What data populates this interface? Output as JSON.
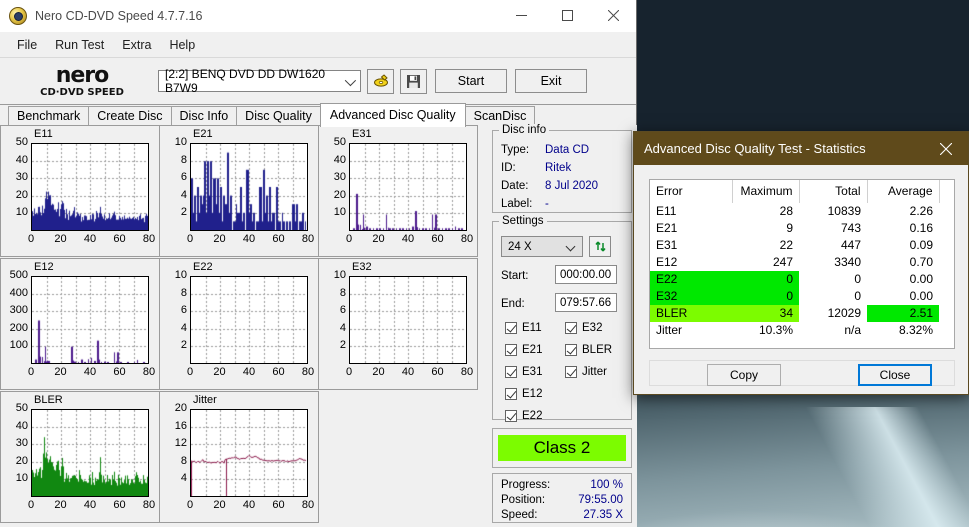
{
  "window": {
    "title": "Nero CD-DVD Speed 4.7.7.16",
    "icon": "nero-disc-icon",
    "minimize_label": "minimize-icon",
    "maximize_label": "maximize-icon",
    "close_label": "close-icon"
  },
  "menu": {
    "items": [
      "File",
      "Run Test",
      "Extra",
      "Help"
    ]
  },
  "toolbar": {
    "logo_line1": "nero",
    "logo_line2": "CD·DVD SPEED",
    "drive": "[2:2]   BENQ DVD DD DW1620 B7W9",
    "eject_icon": "eject-disc-icon",
    "save_icon": "floppy-save-icon",
    "start_label": "Start",
    "exit_label": "Exit"
  },
  "tabs": {
    "items": [
      "Benchmark",
      "Create Disc",
      "Disc Info",
      "Disc Quality",
      "Advanced Disc Quality",
      "ScanDisc"
    ],
    "active": "Advanced Disc Quality"
  },
  "disc_info": {
    "legend": "Disc info",
    "rows": [
      {
        "key": "Type:",
        "value": "Data CD"
      },
      {
        "key": "ID:",
        "value": "Ritek"
      },
      {
        "key": "Date:",
        "value": "8 Jul 2020"
      },
      {
        "key": "Label:",
        "value": "-"
      }
    ]
  },
  "settings": {
    "legend": "Settings",
    "speed": "24 X",
    "refresh_icon": "refresh-speed-icon",
    "start_label": "Start:",
    "start_value": "000:00.00",
    "end_label": "End:",
    "end_value": "079:57.66",
    "checkboxes_left": [
      "E11",
      "E21",
      "E31",
      "E12",
      "E22"
    ],
    "checkboxes_right": [
      "E32",
      "BLER",
      "Jitter"
    ]
  },
  "class": {
    "label": "Class 2",
    "color": "#7cfc00"
  },
  "progress": {
    "rows": [
      {
        "key": "Progress:",
        "value": "100 %"
      },
      {
        "key": "Position:",
        "value": "79:55.00"
      },
      {
        "key": "Speed:",
        "value": "27.35 X"
      }
    ]
  },
  "stats_dialog": {
    "title": "Advanced Disc Quality Test - Statistics",
    "close_icon": "close-icon",
    "columns": [
      "Error",
      "Maximum",
      "Total",
      "Average"
    ],
    "rows": [
      {
        "error": "E11",
        "maximum": "28",
        "total": "10839",
        "average": "2.26",
        "hl_error": false,
        "hl_max": false,
        "hl_avg": false
      },
      {
        "error": "E21",
        "maximum": "9",
        "total": "743",
        "average": "0.16",
        "hl_error": false,
        "hl_max": false,
        "hl_avg": false
      },
      {
        "error": "E31",
        "maximum": "22",
        "total": "447",
        "average": "0.09",
        "hl_error": false,
        "hl_max": false,
        "hl_avg": false
      },
      {
        "error": "E12",
        "maximum": "247",
        "total": "3340",
        "average": "0.70",
        "hl_error": false,
        "hl_max": false,
        "hl_avg": false
      },
      {
        "error": "E22",
        "maximum": "0",
        "total": "0",
        "average": "0.00",
        "hl_error": true,
        "hl_max": true,
        "hl_avg": false,
        "hl_color": "#00e800"
      },
      {
        "error": "E32",
        "maximum": "0",
        "total": "0",
        "average": "0.00",
        "hl_error": true,
        "hl_max": true,
        "hl_avg": false,
        "hl_color": "#00e800"
      },
      {
        "error": "BLER",
        "maximum": "34",
        "total": "12029",
        "average": "2.51",
        "hl_error": true,
        "hl_max": true,
        "hl_avg": true,
        "hl_color": "#7cfc00",
        "hl_avg_color": "#00e800"
      },
      {
        "error": "Jitter",
        "maximum": "10.3%",
        "total": "n/a",
        "average": "8.32%",
        "hl_error": false,
        "hl_max": false,
        "hl_avg": false
      }
    ],
    "copy_label": "Copy",
    "close_label": "Close"
  },
  "chart_data": [
    {
      "type": "bar",
      "title": "E11",
      "xlabel": "",
      "ylabel": "",
      "xlim": [
        0,
        80
      ],
      "ylim": [
        0,
        50
      ],
      "yticks": [
        10,
        20,
        30,
        40,
        50
      ],
      "xticks": [
        0,
        20,
        40,
        60,
        80
      ],
      "color": "#20208c",
      "grid": true,
      "x": [
        0,
        1,
        2,
        3,
        4,
        5,
        6,
        7,
        8,
        9,
        10,
        11,
        12,
        13,
        14,
        15,
        16,
        17,
        18,
        19,
        20,
        21,
        22,
        23,
        24,
        25,
        26,
        27,
        28,
        29,
        30,
        31,
        32,
        33,
        34,
        35,
        36,
        37,
        38,
        39,
        40,
        41,
        42,
        43,
        44,
        45,
        46,
        47,
        48,
        49,
        50,
        51,
        52,
        53,
        54,
        55,
        56,
        57,
        58,
        59,
        60,
        61,
        62,
        63,
        64,
        65,
        66,
        67,
        68,
        69,
        70,
        71,
        72,
        73,
        74,
        75,
        76,
        77,
        78,
        79,
        80
      ],
      "values": [
        14,
        9,
        12,
        10,
        15,
        11,
        8,
        13,
        10,
        18,
        27,
        20,
        26,
        13,
        19,
        12,
        10,
        14,
        16,
        9,
        12,
        17,
        10,
        9,
        12,
        8,
        10,
        7,
        9,
        12,
        7,
        10,
        8,
        11,
        6,
        9,
        7,
        10,
        8,
        6,
        9,
        7,
        10,
        6,
        8,
        11,
        7,
        14,
        8,
        7,
        9,
        6,
        8,
        7,
        9,
        6,
        8,
        10,
        7,
        6,
        9,
        7,
        8,
        6,
        9,
        7,
        8,
        6,
        7,
        9,
        6,
        8,
        7,
        9,
        6,
        8,
        7,
        9,
        6,
        8,
        7
      ]
    },
    {
      "type": "bar",
      "title": "E21",
      "xlabel": "",
      "ylabel": "",
      "xlim": [
        0,
        80
      ],
      "ylim": [
        0,
        10
      ],
      "yticks": [
        2,
        4,
        6,
        8,
        10
      ],
      "xticks": [
        0,
        20,
        40,
        60,
        80
      ],
      "color": "#20208c",
      "grid": true,
      "x": [
        0,
        1,
        2,
        3,
        4,
        5,
        6,
        7,
        8,
        9,
        10,
        11,
        12,
        13,
        14,
        15,
        16,
        17,
        18,
        19,
        20,
        21,
        22,
        23,
        24,
        25,
        26,
        27,
        28,
        29,
        30,
        31,
        32,
        33,
        34,
        35,
        36,
        37,
        38,
        39,
        40,
        41,
        42,
        43,
        44,
        45,
        46,
        47,
        48,
        49,
        50,
        51,
        52,
        53,
        54,
        55,
        56,
        57,
        58,
        59,
        60,
        61,
        62,
        63,
        64,
        65,
        66,
        67,
        68,
        69,
        70,
        71,
        72,
        73,
        74,
        75,
        76,
        77,
        78,
        79,
        80
      ],
      "values": [
        6,
        2,
        4,
        1,
        5,
        2,
        4,
        1,
        3,
        4,
        8,
        2,
        8,
        4,
        8,
        2,
        6,
        3,
        6,
        2,
        5,
        1,
        4,
        2,
        3,
        1,
        9,
        2,
        4,
        0,
        1,
        3,
        1,
        2,
        5,
        1,
        2,
        0,
        1,
        7,
        2,
        1,
        3,
        1,
        2,
        0,
        1,
        2,
        5,
        1,
        7,
        2,
        4,
        1,
        5,
        0,
        1,
        2,
        0,
        1,
        5,
        1,
        0,
        2,
        1,
        0,
        1,
        0,
        0,
        1,
        0,
        3,
        0,
        1,
        3,
        0,
        1,
        2,
        0,
        1,
        0
      ]
    },
    {
      "type": "bar",
      "title": "E31",
      "xlabel": "",
      "ylabel": "",
      "xlim": [
        0,
        80
      ],
      "ylim": [
        0,
        50
      ],
      "yticks": [
        10,
        20,
        30,
        40,
        50
      ],
      "xticks": [
        0,
        20,
        40,
        60,
        80
      ],
      "color": "#4b1a8c",
      "grid": true,
      "x": [
        0,
        1,
        2,
        3,
        4,
        5,
        6,
        7,
        8,
        9,
        10,
        11,
        12,
        13,
        14,
        15,
        16,
        17,
        18,
        19,
        20,
        21,
        22,
        23,
        24,
        25,
        26,
        27,
        28,
        29,
        30,
        31,
        32,
        33,
        34,
        35,
        36,
        37,
        38,
        39,
        40,
        41,
        42,
        43,
        44,
        45,
        46,
        47,
        48,
        49,
        50,
        51,
        52,
        53,
        54,
        55,
        56,
        57,
        58,
        59,
        60,
        61,
        62,
        63,
        64,
        65,
        66,
        67,
        68,
        69,
        70,
        71,
        72,
        73,
        74,
        75,
        76,
        77,
        78,
        79,
        80
      ],
      "values": [
        0,
        0,
        1,
        1,
        2,
        21,
        3,
        1,
        4,
        9,
        3,
        2,
        1,
        0,
        1,
        0,
        1,
        0,
        1,
        0,
        1,
        0,
        0,
        1,
        0,
        1,
        9,
        1,
        1,
        0,
        1,
        1,
        0,
        1,
        0,
        1,
        0,
        1,
        0,
        1,
        1,
        0,
        1,
        2,
        0,
        1,
        11,
        3,
        1,
        0,
        1,
        0,
        1,
        0,
        1,
        0,
        1,
        0,
        9,
        9,
        1,
        0,
        1,
        0,
        1,
        0,
        1,
        0,
        1,
        0,
        1,
        0,
        1,
        2,
        2,
        0,
        1,
        0,
        1,
        0,
        0
      ]
    },
    {
      "type": "bar",
      "title": "E12",
      "xlabel": "",
      "ylabel": "",
      "xlim": [
        0,
        80
      ],
      "ylim": [
        0,
        500
      ],
      "yticks": [
        100,
        200,
        300,
        400,
        500
      ],
      "xticks": [
        0,
        20,
        40,
        60,
        80
      ],
      "color": "#4b1a8c",
      "grid": true,
      "x": [
        0,
        1,
        2,
        3,
        4,
        5,
        6,
        7,
        8,
        9,
        10,
        11,
        12,
        13,
        14,
        15,
        16,
        17,
        18,
        19,
        20,
        21,
        22,
        23,
        24,
        25,
        26,
        27,
        28,
        29,
        30,
        31,
        32,
        33,
        34,
        35,
        36,
        37,
        38,
        39,
        40,
        41,
        42,
        43,
        44,
        45,
        46,
        47,
        48,
        49,
        50,
        51,
        52,
        53,
        54,
        55,
        56,
        57,
        58,
        59,
        60,
        61,
        62,
        63,
        64,
        65,
        66,
        67,
        68,
        69,
        70,
        71,
        72,
        73,
        74,
        75,
        76,
        77,
        78,
        79,
        80
      ],
      "values": [
        0,
        0,
        20,
        8,
        12,
        247,
        35,
        20,
        70,
        60,
        95,
        12,
        8,
        0,
        5,
        0,
        3,
        0,
        4,
        0,
        2,
        0,
        3,
        0,
        2,
        0,
        0,
        2,
        95,
        8,
        2,
        4,
        2,
        6,
        2,
        20,
        6,
        4,
        18,
        22,
        4,
        30,
        6,
        12,
        8,
        20,
        130,
        20,
        6,
        4,
        8,
        2,
        6,
        2,
        4,
        2,
        6,
        2,
        62,
        62,
        8,
        2,
        6,
        2,
        4,
        2,
        6,
        2,
        4,
        2,
        6,
        2,
        4,
        18,
        18,
        2,
        4,
        2,
        6,
        2,
        0
      ]
    },
    {
      "type": "bar",
      "title": "E22",
      "xlabel": "",
      "ylabel": "",
      "xlim": [
        0,
        80
      ],
      "ylim": [
        0,
        10
      ],
      "yticks": [
        2,
        4,
        6,
        8,
        10
      ],
      "xticks": [
        0,
        20,
        40,
        60,
        80
      ],
      "color": "#20208c",
      "grid": true,
      "x": [
        0,
        20,
        40,
        60,
        80
      ],
      "values": [
        0,
        0,
        0,
        0,
        0
      ]
    },
    {
      "type": "bar",
      "title": "E32",
      "xlabel": "",
      "ylabel": "",
      "xlim": [
        0,
        80
      ],
      "ylim": [
        0,
        10
      ],
      "yticks": [
        2,
        4,
        6,
        8,
        10
      ],
      "xticks": [
        0,
        20,
        40,
        60,
        80
      ],
      "color": "#4b1a8c",
      "grid": true,
      "x": [
        0,
        20,
        40,
        60,
        80
      ],
      "values": [
        0,
        0,
        0,
        0,
        0
      ]
    },
    {
      "type": "bar",
      "title": "BLER",
      "xlabel": "",
      "ylabel": "",
      "xlim": [
        0,
        80
      ],
      "ylim": [
        0,
        50
      ],
      "yticks": [
        10,
        20,
        30,
        40,
        50
      ],
      "xticks": [
        0,
        20,
        40,
        60,
        80
      ],
      "color": "#118811",
      "grid": true,
      "x": [
        0,
        1,
        2,
        3,
        4,
        5,
        6,
        7,
        8,
        9,
        10,
        11,
        12,
        13,
        14,
        15,
        16,
        17,
        18,
        19,
        20,
        21,
        22,
        23,
        24,
        25,
        26,
        27,
        28,
        29,
        30,
        31,
        32,
        33,
        34,
        35,
        36,
        37,
        38,
        39,
        40,
        41,
        42,
        43,
        44,
        45,
        46,
        47,
        48,
        49,
        50,
        51,
        52,
        53,
        54,
        55,
        56,
        57,
        58,
        59,
        60,
        61,
        62,
        63,
        64,
        65,
        66,
        67,
        68,
        69,
        70,
        71,
        72,
        73,
        74,
        75,
        76,
        77,
        78,
        79,
        80
      ],
      "values": [
        19,
        12,
        16,
        14,
        19,
        16,
        12,
        18,
        34,
        23,
        26,
        18,
        30,
        16,
        22,
        14,
        13,
        17,
        19,
        12,
        15,
        20,
        12,
        11,
        15,
        10,
        12,
        9,
        11,
        14,
        9,
        12,
        10,
        13,
        8,
        11,
        9,
        12,
        10,
        8,
        11,
        9,
        12,
        8,
        10,
        13,
        9,
        26,
        10,
        9,
        11,
        8,
        10,
        9,
        11,
        8,
        13,
        12,
        9,
        8,
        11,
        9,
        10,
        8,
        11,
        9,
        10,
        8,
        9,
        11,
        8,
        10,
        9,
        15,
        8,
        10,
        9,
        11,
        8,
        10,
        9
      ]
    },
    {
      "type": "line",
      "title": "Jitter",
      "xlabel": "",
      "ylabel": "",
      "xlim": [
        0,
        80
      ],
      "ylim": [
        0,
        20
      ],
      "yticks": [
        4,
        8,
        12,
        16,
        20
      ],
      "xticks": [
        0,
        20,
        40,
        60,
        80
      ],
      "color": "#8b1a4b",
      "grid": true,
      "x": [
        0,
        1,
        2,
        3,
        4,
        5,
        6,
        7,
        8,
        9,
        10,
        11,
        12,
        13,
        14,
        15,
        16,
        17,
        18,
        19,
        20,
        21,
        22,
        23,
        24,
        25,
        26,
        27,
        28,
        29,
        30,
        31,
        32,
        33,
        34,
        35,
        36,
        37,
        38,
        39,
        40,
        41,
        42,
        43,
        44,
        45,
        46,
        47,
        48,
        49,
        50,
        51,
        52,
        53,
        54,
        55,
        56,
        57,
        58,
        59,
        60,
        61,
        62,
        63,
        64,
        65,
        66,
        67,
        68,
        69,
        70,
        71,
        72,
        73,
        74,
        75,
        76,
        77,
        78,
        79,
        80
      ],
      "values": [
        8.0,
        8.1,
        8.0,
        7.9,
        7.9,
        8.1,
        7.9,
        8.0,
        8.5,
        8.0,
        7.9,
        8.0,
        7.8,
        7.9,
        7.8,
        7.8,
        7.9,
        7.8,
        7.8,
        7.9,
        7.8,
        7.9,
        7.9,
        7.8,
        8.6,
        8.5,
        8.6,
        8.7,
        8.8,
        8.9,
        9.0,
        9.1,
        8.9,
        8.7,
        8.6,
        8.7,
        8.9,
        8.6,
        8.8,
        9.1,
        9.4,
        9.2,
        9.0,
        8.8,
        9.3,
        9.1,
        8.9,
        8.8,
        8.6,
        8.4,
        8.3,
        8.4,
        8.3,
        8.2,
        8.2,
        8.3,
        8.2,
        8.2,
        8.3,
        8.2,
        8.2,
        8.1,
        8.2,
        8.1,
        8.2,
        8.1,
        8.1,
        8.2,
        8.1,
        8.1,
        8.2,
        8.1,
        8.1,
        8.2,
        8.3,
        8.5,
        8.7,
        8.6,
        8.4,
        8.3,
        8.3
      ]
    }
  ]
}
